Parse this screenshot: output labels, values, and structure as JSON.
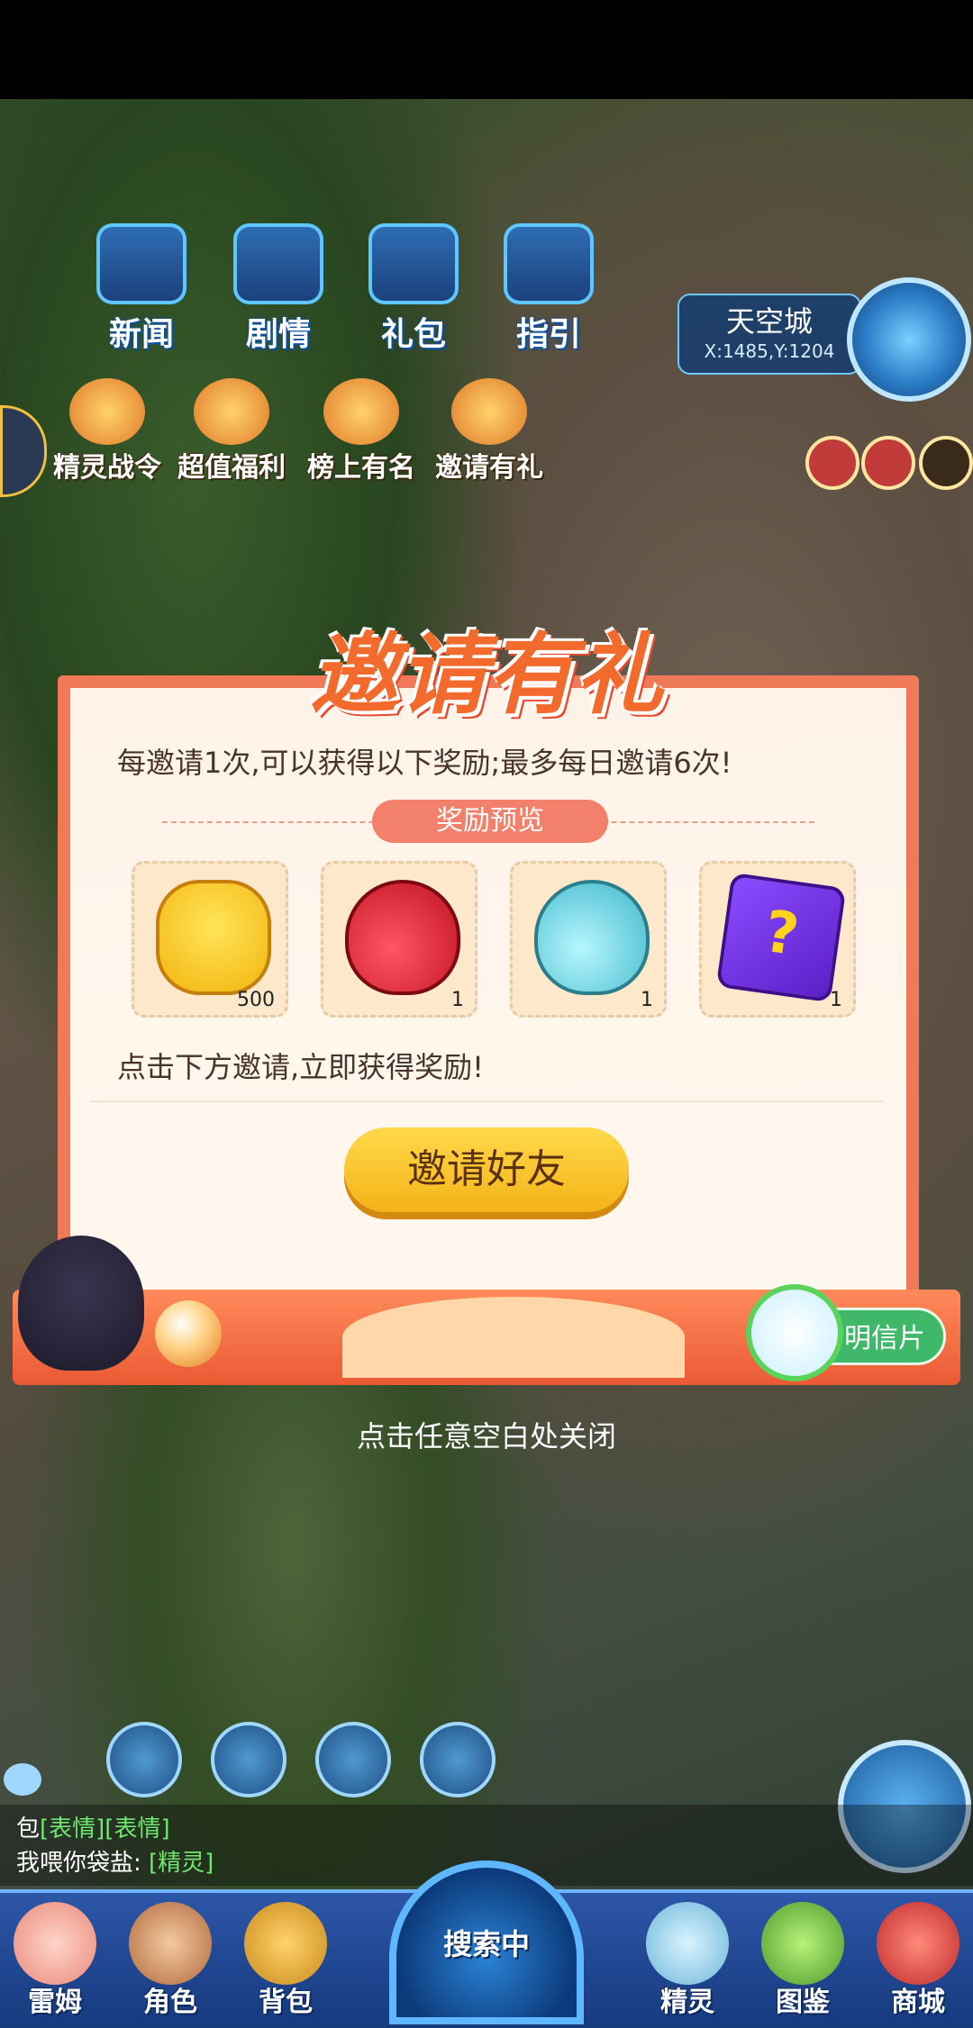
{
  "hud": {
    "top_buttons": [
      "新闻",
      "剧情",
      "礼包",
      "指引"
    ],
    "second_row": [
      "精灵战令",
      "超值福利",
      "榜上有名",
      "邀请有礼"
    ],
    "city_name": "天空城",
    "coords": "X:1485,Y:1204"
  },
  "modal": {
    "title": "邀请有礼",
    "description": "每邀请1次,可以获得以下奖励;最多每日邀请6次!",
    "preview_label": "奖励预览",
    "rewards": [
      {
        "icon": "cat-coin-icon",
        "qty": "500"
      },
      {
        "icon": "red-potion-icon",
        "qty": "1"
      },
      {
        "icon": "blue-potion-icon",
        "qty": "1"
      },
      {
        "icon": "mystery-puzzle-icon",
        "symbol": "?",
        "qty": "1"
      }
    ],
    "hint": "点击下方邀请,立即获得奖励!",
    "invite_button": "邀请好友",
    "postcard_label": "明信片"
  },
  "close_hint": "点击任意空白处关闭",
  "chat": {
    "line1_prefix": "包",
    "line1_tags": "[表情][表情]",
    "line2_text": "我喂你袋盐:",
    "line2_tag": "[精灵]"
  },
  "nav": {
    "items": [
      "雷姆",
      "角色",
      "背包",
      "精灵",
      "图鉴",
      "商城"
    ],
    "radar": "搜索中"
  }
}
